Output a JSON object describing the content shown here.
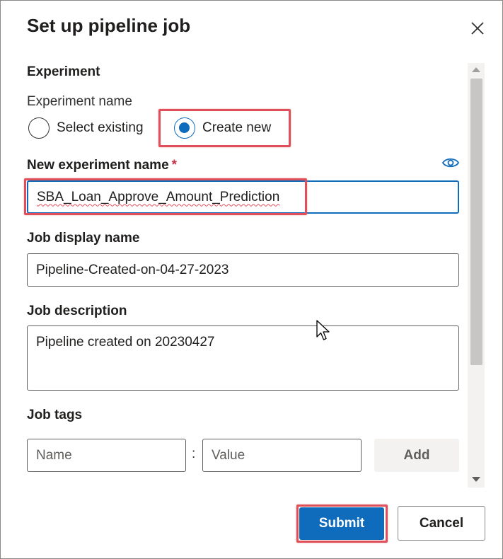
{
  "dialog": {
    "title": "Set up pipeline job",
    "close_icon": "close-icon"
  },
  "experiment": {
    "section_title": "Experiment",
    "name_label": "Experiment name",
    "options": [
      {
        "label": "Select existing",
        "checked": false
      },
      {
        "label": "Create new",
        "checked": true
      }
    ],
    "new_name_label": "New experiment name",
    "required_marker": "*",
    "visibility_icon": "eye-icon",
    "new_name_value": "SBA_Loan_Approve_Amount_Prediction"
  },
  "job": {
    "display_name_label": "Job display name",
    "display_name_value": "Pipeline-Created-on-04-27-2023",
    "description_label": "Job description",
    "description_value": "Pipeline created on 20230427",
    "tags_label": "Job tags",
    "tag_name_placeholder": "Name",
    "tag_separator": ":",
    "tag_value_placeholder": "Value",
    "add_label": "Add"
  },
  "footer": {
    "submit_label": "Submit",
    "cancel_label": "Cancel"
  },
  "colors": {
    "primary": "#0f6cbd",
    "highlight": "#e0505a",
    "required": "#c4314b"
  }
}
